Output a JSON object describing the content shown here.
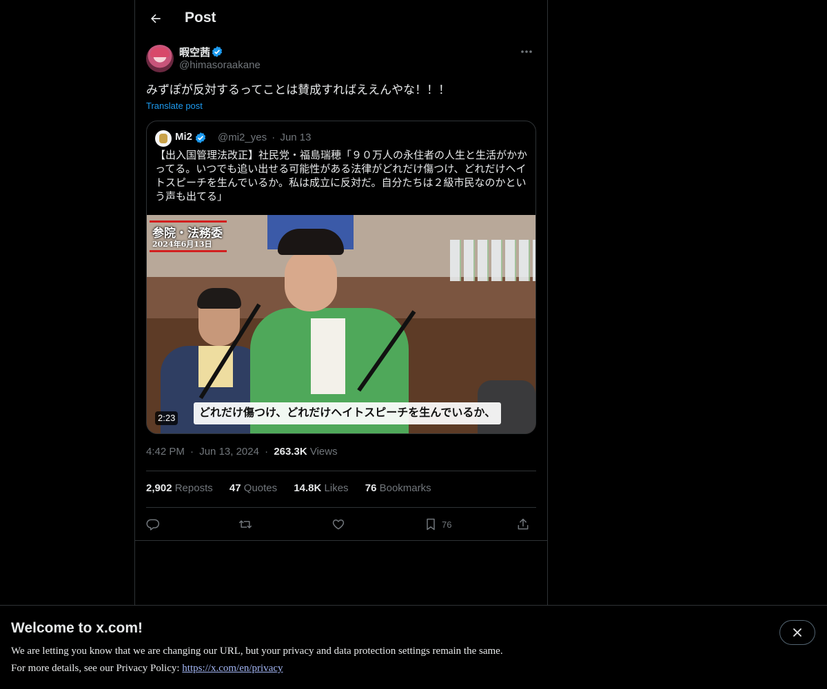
{
  "header": {
    "title": "Post"
  },
  "post": {
    "author_name": "暇空茜",
    "author_handle": "@himasoraakane",
    "text": "みずぽが反対するってことは賛成すればええんやな！！！",
    "translate_label": "Translate post",
    "timestamp_time": "4:42 PM",
    "timestamp_date": "Jun 13, 2024",
    "views_count": "263.3K",
    "views_label": "Views"
  },
  "quote": {
    "author_name": "Mi2",
    "author_handle": "@mi2_yes",
    "separator": "·",
    "date": "Jun 13",
    "text": "【出入国管理法改正】社民党・福島瑞穂「９０万人の永住者の人生と生活がかかってる。いつでも追い出せる可能性がある法律がどれだけ傷つけ、どれだけヘイトスピーチを生んでいるか。私は成立に反対だ。自分たちは２級市民なのかという声も出てる」",
    "video": {
      "badge_title": "参院・法務委",
      "badge_date": "2024年6月13日",
      "duration": "2:23",
      "caption": "どれだけ傷つけ、どれだけヘイトスピーチを生んでいるか、"
    }
  },
  "stats": [
    {
      "count": "2,902",
      "label": "Reposts"
    },
    {
      "count": "47",
      "label": "Quotes"
    },
    {
      "count": "14.8K",
      "label": "Likes"
    },
    {
      "count": "76",
      "label": "Bookmarks"
    }
  ],
  "actions": {
    "reply_icon": "reply-icon",
    "repost_icon": "repost-icon",
    "like_icon": "heart-icon",
    "bookmark_icon": "bookmark-icon",
    "bookmark_count": "76",
    "share_icon": "share-icon"
  },
  "banner": {
    "title": "Welcome to x.com!",
    "line1": "We are letting you know that we are changing our URL, but your privacy and data protection settings remain the same.",
    "line2_prefix": "For more details, see our Privacy Policy: ",
    "link_text": "https://x.com/en/privacy"
  },
  "colors": {
    "background": "#000000",
    "text": "#e7e9ea",
    "muted": "#71767b",
    "accent": "#1d9bf0",
    "border": "#2f3336"
  }
}
